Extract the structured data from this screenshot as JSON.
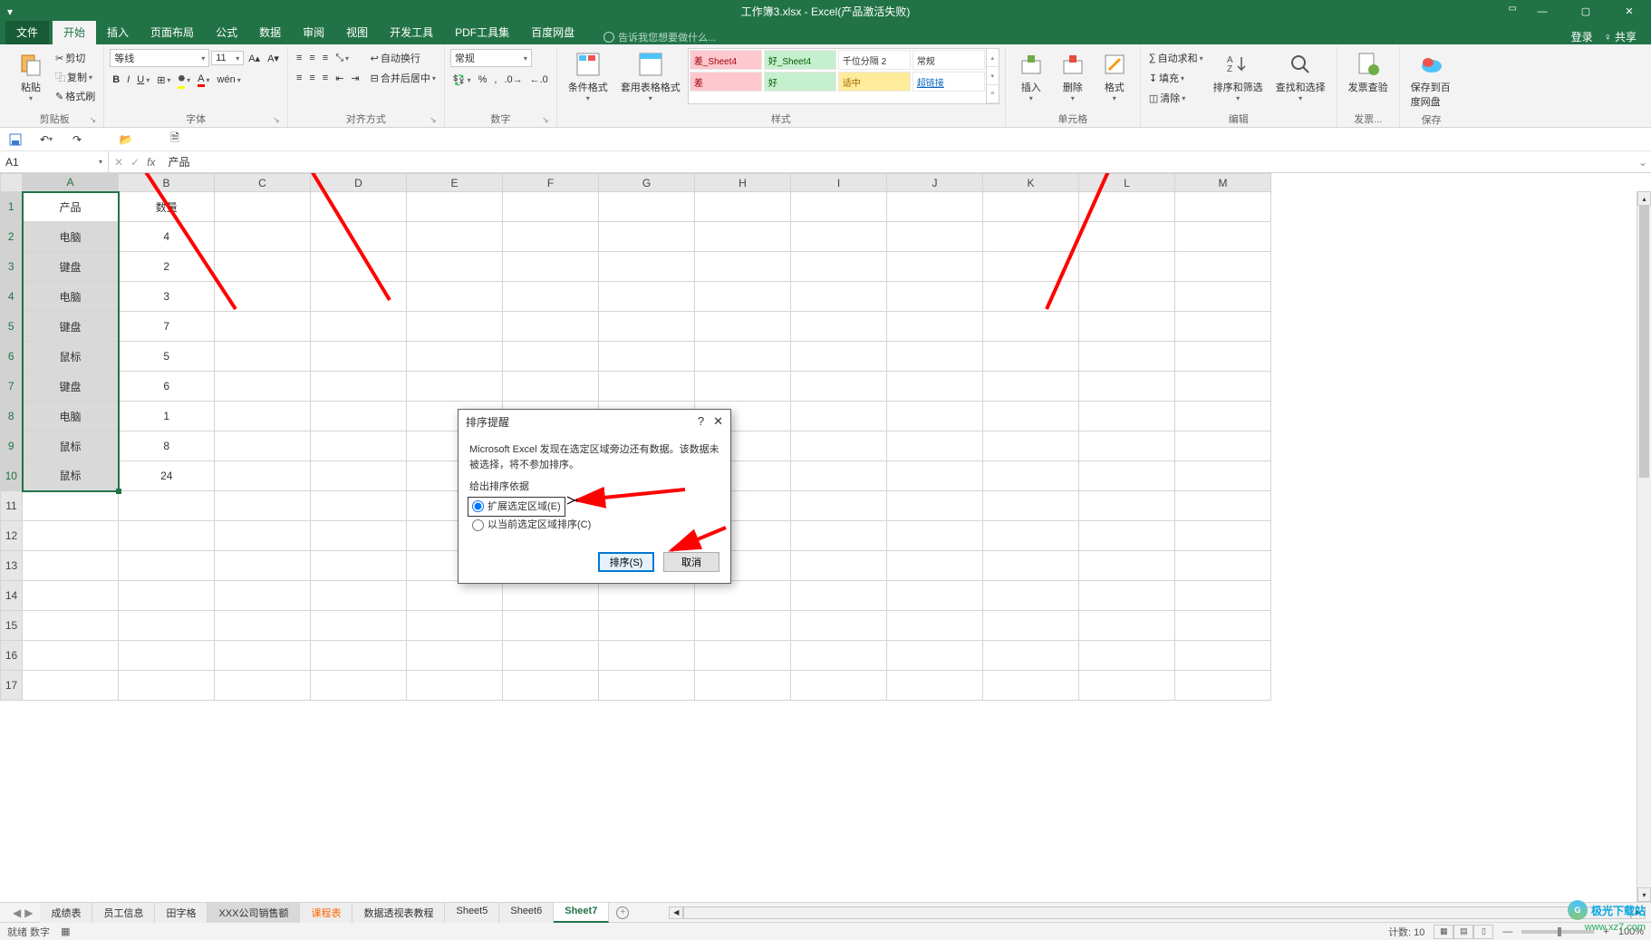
{
  "title": "工作簿3.xlsx - Excel(产品激活失败)",
  "titlebar": {
    "login": "登录",
    "share": "共享"
  },
  "menu": {
    "file": "文件",
    "items": [
      "开始",
      "插入",
      "页面布局",
      "公式",
      "数据",
      "审阅",
      "视图",
      "开发工具",
      "PDF工具集",
      "百度网盘"
    ],
    "active_index": 0,
    "tell_me": "告诉我您想要做什么..."
  },
  "ribbon": {
    "clipboard": {
      "label": "剪贴板",
      "paste": "粘贴",
      "cut": "剪切",
      "copy": "复制",
      "painter": "格式刷"
    },
    "font": {
      "label": "字体",
      "name": "等线",
      "size": "11",
      "buttons": [
        "B",
        "I",
        "U"
      ]
    },
    "align": {
      "label": "对齐方式",
      "wrap": "自动换行",
      "merge": "合并后居中"
    },
    "number": {
      "label": "数字",
      "format": "常规"
    },
    "styles": {
      "label": "样式",
      "cond": "条件格式",
      "table": "套用表格格式",
      "gallery": [
        {
          "text": "差_Sheet4",
          "cls": "style-bad"
        },
        {
          "text": "好_Sheet4",
          "cls": "style-good"
        },
        {
          "text": "千位分隔 2",
          "cls": "style-thousand"
        },
        {
          "text": "常规",
          "cls": "style-normal"
        },
        {
          "text": "差",
          "cls": "style-bad"
        },
        {
          "text": "好",
          "cls": "style-good"
        },
        {
          "text": "适中",
          "cls": "style-neutral"
        },
        {
          "text": "超链接",
          "cls": "style-link"
        }
      ]
    },
    "cells": {
      "label": "单元格",
      "insert": "插入",
      "delete": "删除",
      "format": "格式"
    },
    "editing": {
      "label": "编辑",
      "sum": "自动求和",
      "fill": "填充",
      "clear": "清除",
      "sort": "排序和筛选",
      "find": "查找和选择"
    },
    "invoice": {
      "label": "发票...",
      "btn": "发票查验"
    },
    "save": {
      "label": "保存",
      "btn": "保存到百度网盘"
    }
  },
  "formula": {
    "cell": "A1",
    "value": "产品"
  },
  "grid": {
    "cols": [
      "A",
      "B",
      "C",
      "D",
      "E",
      "F",
      "G",
      "H",
      "I",
      "J",
      "K",
      "L",
      "M"
    ],
    "rows": 17,
    "data": [
      [
        "产品",
        "数量"
      ],
      [
        "电脑",
        "4"
      ],
      [
        "键盘",
        "2"
      ],
      [
        "电脑",
        "3"
      ],
      [
        "键盘",
        "7"
      ],
      [
        "鼠标",
        "5"
      ],
      [
        "键盘",
        "6"
      ],
      [
        "电脑",
        "1"
      ],
      [
        "鼠标",
        "8"
      ],
      [
        "鼠标",
        "24"
      ]
    ]
  },
  "dialog": {
    "title": "排序提醒",
    "msg": "Microsoft Excel 发现在选定区域旁边还有数据。该数据未被选择，将不参加排序。",
    "legend": "给出排序依据",
    "opt1": "扩展选定区域(E)",
    "opt2": "以当前选定区域排序(C)",
    "sort_btn": "排序(S)",
    "cancel_btn": "取消"
  },
  "sheets": {
    "tabs": [
      "成绩表",
      "员工信息",
      "田字格",
      "XXX公司销售额",
      "课程表",
      "数据透视表教程",
      "Sheet5",
      "Sheet6",
      "Sheet7"
    ],
    "active_index": 8,
    "orange_index": 4
  },
  "status": {
    "left": "就绪   数字",
    "count": "计数: 10",
    "zoom": "100%"
  },
  "watermark": {
    "name": "极光下载站",
    "url": "www.xz7.com"
  }
}
